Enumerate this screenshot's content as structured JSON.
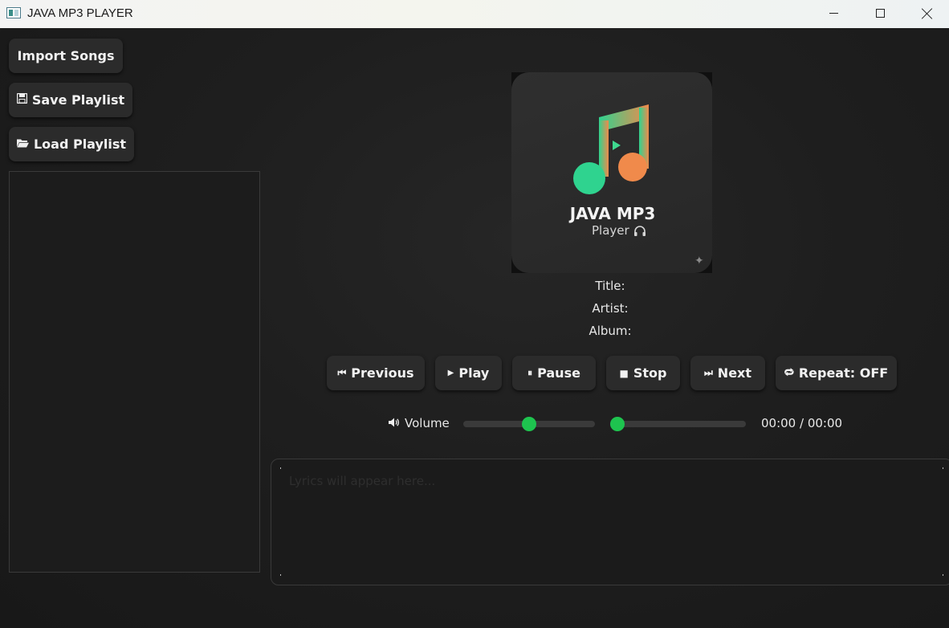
{
  "window": {
    "title": "JAVA MP3 PLAYER"
  },
  "sidebar": {
    "import_label": "Import Songs",
    "save_label": "Save Playlist",
    "load_label": "Load Playlist",
    "save_icon": "floppy-disk-icon",
    "load_icon": "open-folder-icon"
  },
  "album_art": {
    "title": "JAVA MP3",
    "subtitle": "Player",
    "gradient_start": "#2fd38f",
    "gradient_end": "#f08a4b"
  },
  "track_info": {
    "title_label": "Title:",
    "artist_label": "Artist:",
    "album_label": "Album:"
  },
  "controls": {
    "previous": "Previous",
    "play": "Play",
    "pause": "Pause",
    "stop": "Stop",
    "next": "Next",
    "repeat": "Repeat: OFF"
  },
  "volume": {
    "label": "Volume",
    "level_fraction": 0.5
  },
  "seek": {
    "position_fraction": 0.0,
    "time": "00:00 / 00:00"
  },
  "lyrics": {
    "placeholder": "Lyrics will appear here..."
  },
  "colors": {
    "accent": "#1ec44f",
    "background": "#1b1b1b",
    "button": "#2b2b2b"
  }
}
